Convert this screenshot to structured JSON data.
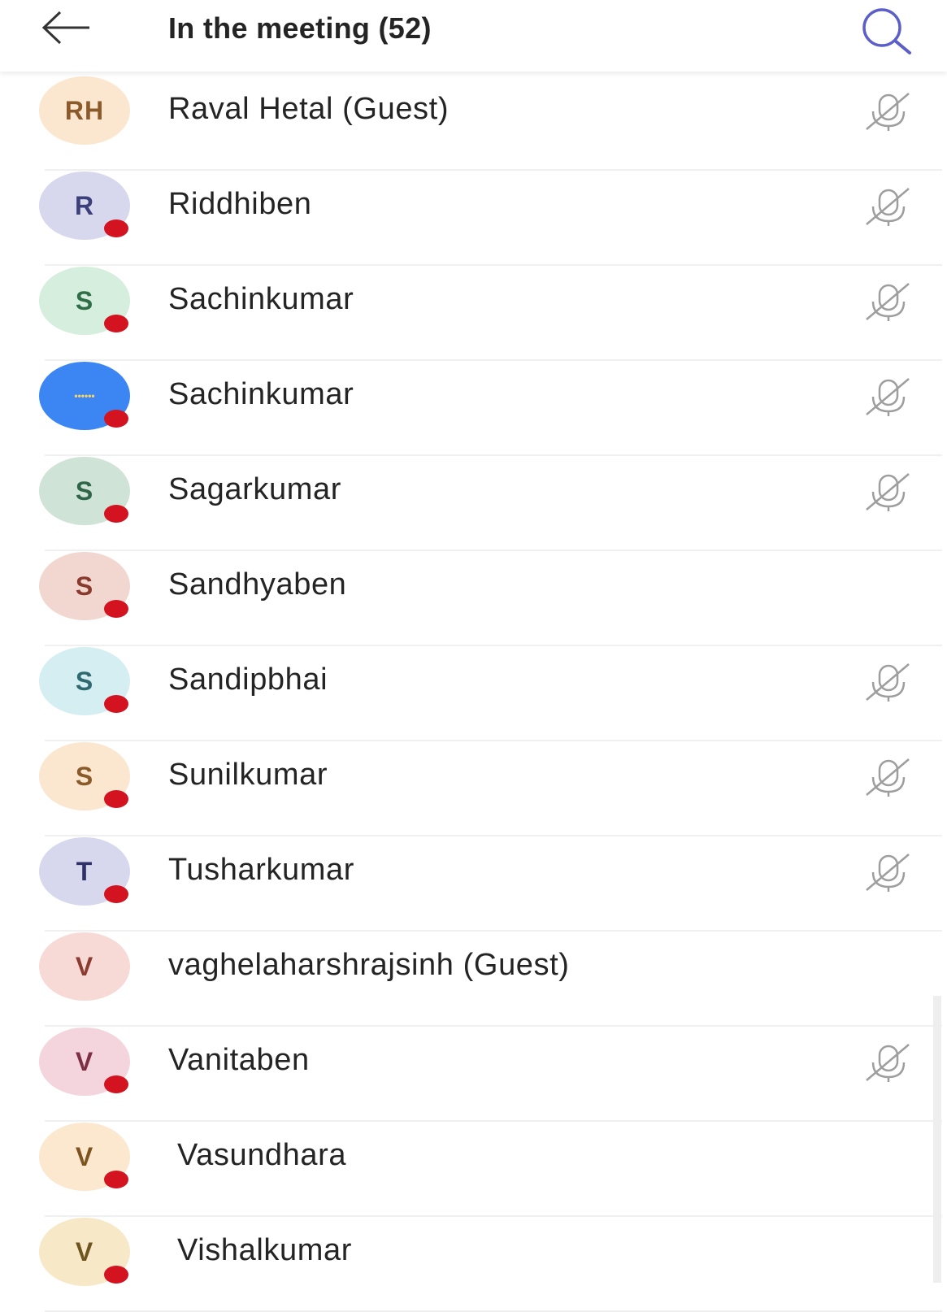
{
  "header": {
    "title": "In the meeting (52)",
    "back_icon": "arrow-left-icon",
    "search_icon": "search-icon"
  },
  "colors": {
    "status_busy": "#d3131f",
    "mic_muted": "#9e9e9e",
    "text": "#242424"
  },
  "participants": [
    {
      "initials": "RH",
      "name": "Raval Hetal (Guest)",
      "avatar_bg": "#fbe6cf",
      "avatar_fg": "#8a5a2b",
      "status": false,
      "muted": true
    },
    {
      "initials": "R",
      "name": "Riddhiben",
      "avatar_bg": "#d7d8ee",
      "avatar_fg": "#3b3f7a",
      "status": true,
      "muted": true
    },
    {
      "initials": "S",
      "name": "Sachinkumar",
      "avatar_bg": "#d5eedd",
      "avatar_fg": "#2f6e46",
      "status": true,
      "muted": true
    },
    {
      "initials": "",
      "name": "Sachinkumar",
      "avatar_bg": "#3b86f2",
      "avatar_fg": "#ffffff",
      "status": true,
      "muted": true,
      "picture": true
    },
    {
      "initials": "S",
      "name": "Sagarkumar",
      "avatar_bg": "#cfe3d6",
      "avatar_fg": "#2f6648",
      "status": true,
      "muted": true
    },
    {
      "initials": "S",
      "name": "Sandhyaben",
      "avatar_bg": "#f2d6d0",
      "avatar_fg": "#8a3a2c",
      "status": true,
      "muted": false
    },
    {
      "initials": "S",
      "name": "Sandipbhai",
      "avatar_bg": "#d5eef1",
      "avatar_fg": "#2f6a72",
      "status": true,
      "muted": true
    },
    {
      "initials": "S",
      "name": "Sunilkumar",
      "avatar_bg": "#fbe6cf",
      "avatar_fg": "#8a5a2b",
      "status": true,
      "muted": true
    },
    {
      "initials": "T",
      "name": "Tusharkumar",
      "avatar_bg": "#d7d8ee",
      "avatar_fg": "#2e3166",
      "status": true,
      "muted": true
    },
    {
      "initials": "V",
      "name": "vaghelaharshrajsinh (Guest)",
      "avatar_bg": "#f7dad6",
      "avatar_fg": "#8c3b30",
      "status": false,
      "muted": false
    },
    {
      "initials": "V",
      "name": "Vanitaben",
      "avatar_bg": "#f4d5de",
      "avatar_fg": "#7d2f44",
      "status": true,
      "muted": true
    },
    {
      "initials": "V",
      "name": "Vasundhara",
      "avatar_bg": "#fbe8cf",
      "avatar_fg": "#7d5420",
      "status": true,
      "muted": false
    },
    {
      "initials": "V",
      "name": "Vishalkumar",
      "avatar_bg": "#f7e8c8",
      "avatar_fg": "#6e5520",
      "status": true,
      "muted": false
    }
  ]
}
